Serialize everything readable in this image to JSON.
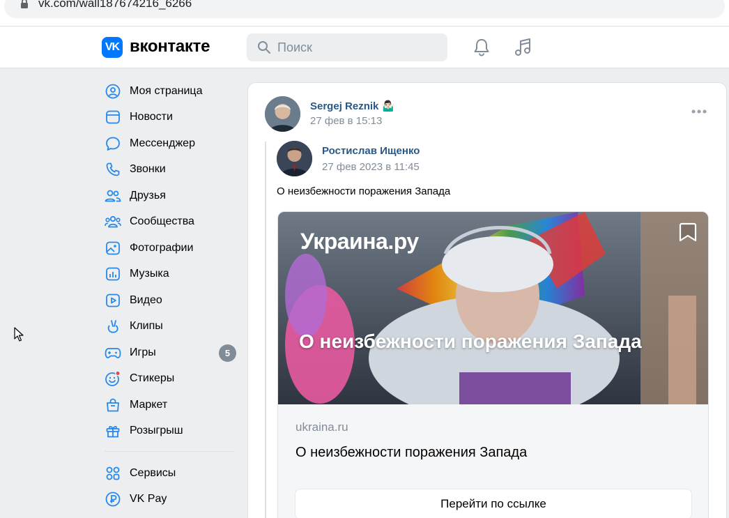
{
  "browser": {
    "url": "vk.com/wall187674216_6266"
  },
  "header": {
    "logo_mark": "VK",
    "logo_text": "вконтакте",
    "search_placeholder": "Поиск"
  },
  "sidebar": {
    "items": [
      {
        "label": "Моя страница",
        "icon": "user-circle-icon"
      },
      {
        "label": "Новости",
        "icon": "news-icon"
      },
      {
        "label": "Мессенджер",
        "icon": "message-icon"
      },
      {
        "label": "Звонки",
        "icon": "phone-icon"
      },
      {
        "label": "Друзья",
        "icon": "friends-icon"
      },
      {
        "label": "Сообщества",
        "icon": "communities-icon"
      },
      {
        "label": "Фотографии",
        "icon": "photo-icon"
      },
      {
        "label": "Музыка",
        "icon": "music-icon"
      },
      {
        "label": "Видео",
        "icon": "video-icon"
      },
      {
        "label": "Клипы",
        "icon": "clips-icon"
      },
      {
        "label": "Игры",
        "icon": "games-icon",
        "badge": "5"
      },
      {
        "label": "Стикеры",
        "icon": "stickers-icon"
      },
      {
        "label": "Маркет",
        "icon": "market-icon"
      },
      {
        "label": "Розыгрыш",
        "icon": "gift-icon"
      }
    ],
    "extra_items": [
      {
        "label": "Сервисы",
        "icon": "services-icon"
      },
      {
        "label": "VK Pay",
        "icon": "vkpay-icon"
      }
    ]
  },
  "post": {
    "author": "Sergej Reznik",
    "author_emoji": "🤷🏻‍♂️",
    "date": "27 фев в 15:13",
    "repost": {
      "author": "Ростислав Ищенко",
      "date": "27 фев 2023 в 11:45",
      "text": "О неизбежности поражения Запада",
      "link": {
        "image_brand": "Украина.ру",
        "image_title": "О неизбежности поражения Запада",
        "domain": "ukraina.ru",
        "title": "О неизбежности поражения Запада",
        "button_label": "Перейти по ссылке"
      }
    }
  },
  "colors": {
    "accent": "#0077ff",
    "link": "#2a5885",
    "secondary_text": "#818c99",
    "page_bg": "#edeef0"
  }
}
